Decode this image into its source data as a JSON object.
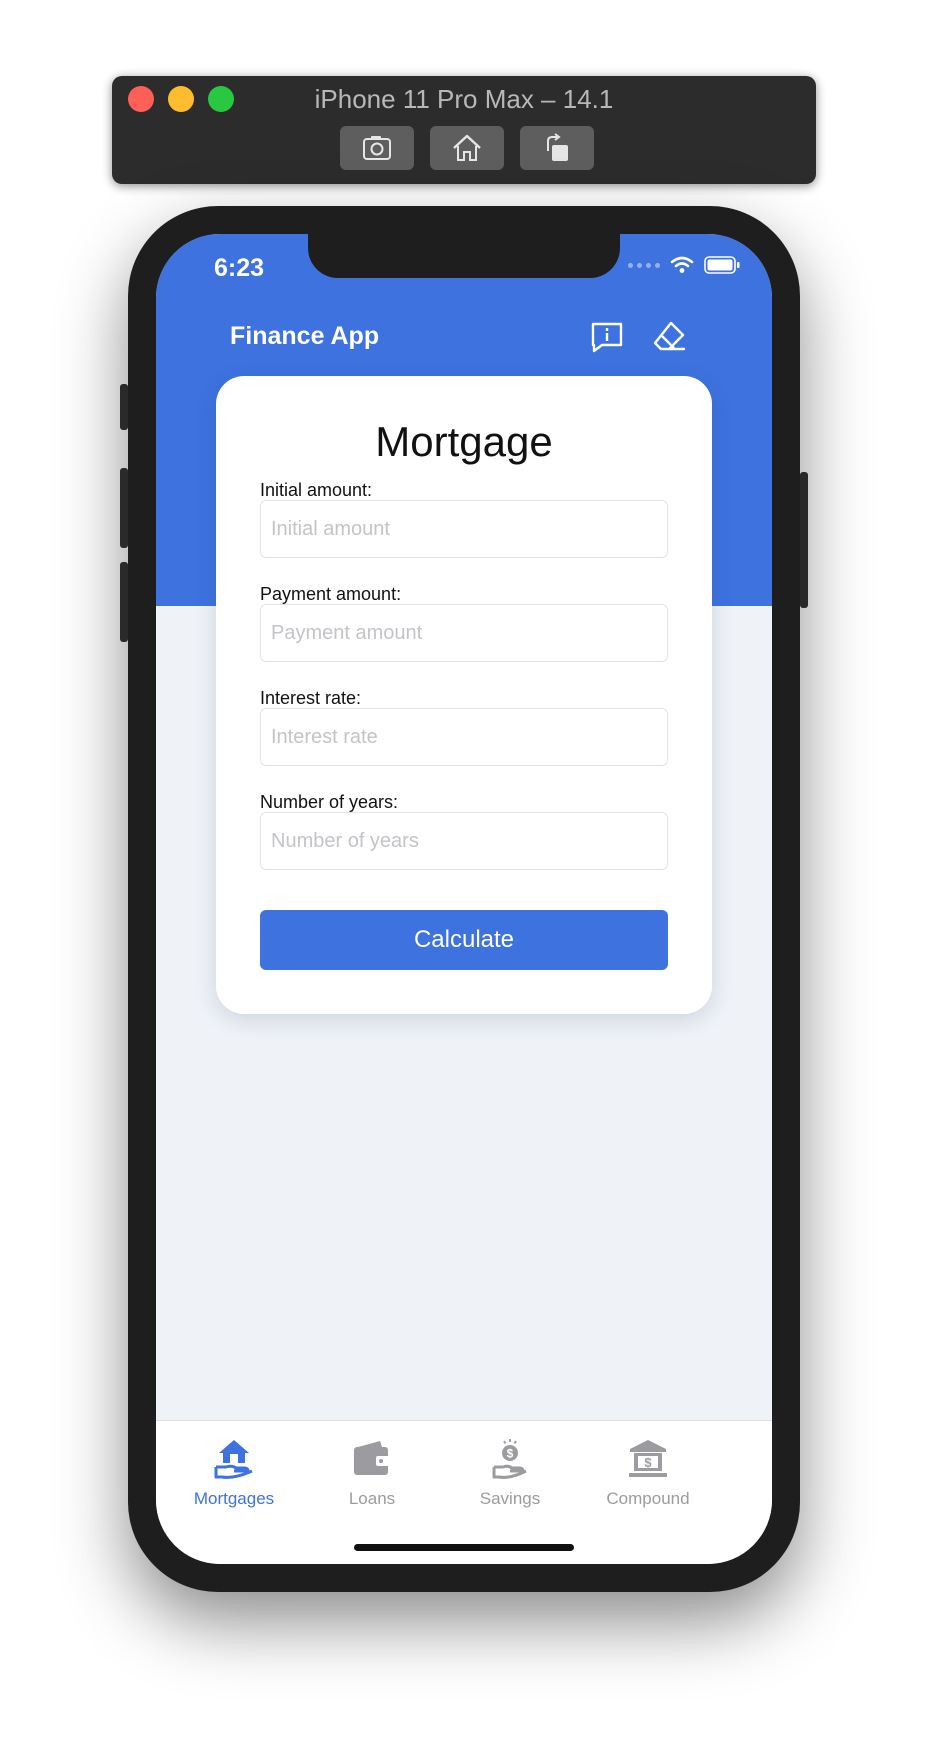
{
  "simulator": {
    "title": "iPhone 11 Pro Max – 14.1",
    "buttons": [
      "screenshot-icon",
      "home-icon",
      "rotate-icon"
    ]
  },
  "status_bar": {
    "time": "6:23"
  },
  "header": {
    "title": "Finance App",
    "actions": [
      "feedback-icon",
      "eraser-icon"
    ]
  },
  "form": {
    "title": "Mortgage",
    "fields": [
      {
        "label": "Initial amount:",
        "placeholder": "Initial amount",
        "value": ""
      },
      {
        "label": "Payment amount:",
        "placeholder": "Payment amount",
        "value": ""
      },
      {
        "label": "Interest rate:",
        "placeholder": "Interest rate",
        "value": ""
      },
      {
        "label": "Number of years:",
        "placeholder": "Number of years",
        "value": ""
      }
    ],
    "submit_label": "Calculate"
  },
  "tabs": [
    {
      "label": "Mortgages",
      "icon": "house-hand-icon",
      "active": true
    },
    {
      "label": "Loans",
      "icon": "wallet-icon",
      "active": false
    },
    {
      "label": "Savings",
      "icon": "coin-hand-icon",
      "active": false
    },
    {
      "label": "Compound",
      "icon": "bank-icon",
      "active": false
    }
  ],
  "colors": {
    "primary": "#3e72df",
    "background": "#eff2f7",
    "inactive_tab": "#9c9ca0"
  }
}
